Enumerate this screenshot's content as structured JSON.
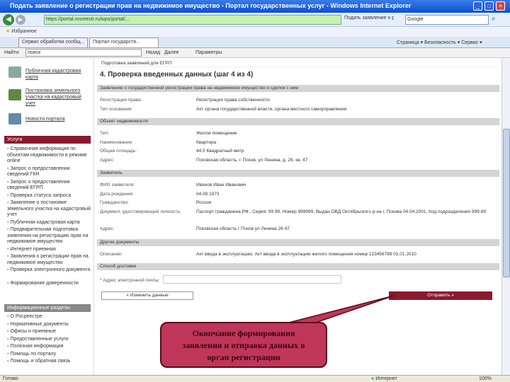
{
  "window": {
    "title": "Подать заявление о регистрации прав на недвижимое имущество - Портал государственных услуг - Windows Internet Explorer"
  },
  "browser": {
    "url": "https://portal.rosreestr.ru/wps/portal/...",
    "page_label": "Подать заявление о регистрации...",
    "search_placeholder": "Google",
    "favorites": "Избранное",
    "tabs": [
      {
        "label": "Сервис обработки сообщ..."
      },
      {
        "label": "Портал государств..."
      }
    ],
    "toolbar_right": [
      "Страница",
      "Безопасность",
      "Сервис"
    ],
    "find_label": "Найти:",
    "find_value": "поиск",
    "find_prev": "Назад",
    "find_next": "Далее",
    "find_options": "Параметры"
  },
  "sidebar": {
    "top_links": [
      {
        "label": "Публичная кадастровая карта"
      },
      {
        "label": "Постановка земельного участка на кадастровый учет"
      },
      {
        "label": "Новости портала"
      }
    ],
    "services_title": "Услуги",
    "services": [
      "Справочная информация по объектам недвижимости в режиме online",
      "Запрос о предоставлении сведений ГКН",
      "Запрос о предоставлении сведений ЕГРП",
      "Проверка статуса запроса",
      "Заявление о постановке земельного участка на кадастровый учет",
      "Публичная кадастровая карта",
      "Предварительная подготовка заявления на регистрацию прав на недвижимое имущество",
      "Интернет приемная",
      "Заявления о регистрации прав на недвижимое имущество",
      "Проверка электронного документа",
      "Формирование доверенности"
    ],
    "info_title": "Информационные разделы",
    "info": [
      "О Росреестре",
      "Нормативные документы",
      "Офисы и приемные",
      "Предоставленные услуги",
      "Полезная информация",
      "Помощь по порталу",
      "Помощь и обратная связь"
    ]
  },
  "main": {
    "breadcrumb": "Подготовка заявлений для ЕГРП",
    "heading": "4. Проверка введенных данных (шаг 4 из 4)",
    "sections": [
      {
        "title": "Заявление о государственной регистрации права на недвижимое имущество и сделок с ним",
        "rows": [
          [
            "Регистрация права:",
            "Регистрация права собственности"
          ],
          [
            "Тип основания:",
            "Акт органа государственной власти, органа местного самоуправления"
          ]
        ]
      },
      {
        "title": "Объект недвижимости",
        "rows": [
          [
            "Тип:",
            "Жилое помещение"
          ],
          [
            "Наименование:",
            "Квартира"
          ],
          [
            "Общая площадь:",
            "44.5 Квадратный метр"
          ],
          [
            "Адрес:",
            "Псковская область, г. Псков, ул Ленина, д. 26, кв. 47"
          ]
        ]
      },
      {
        "title": "Заявитель",
        "rows": [
          [
            "ФИО заявителя:",
            "Иванов Иван Иванович"
          ],
          [
            "Дата рождения:",
            "04.08.1973"
          ],
          [
            "Гражданство:",
            "Россия"
          ],
          [
            "Документ, удостоверяющий личность:",
            "Паспорт гражданина РФ , Серия: 99 99, Номер 999999, Выдан ОВД Октябрьского р-на г. Пскова 04.04.2001, Код подразделения 999-99"
          ],
          [
            "Адрес:",
            "Псковская область г Псков ул Ленина 26 47"
          ]
        ]
      },
      {
        "title": "Другие документы",
        "rows": [
          [
            "Описание:",
            "Акт ввода в эксплуатацию, Акт ввода в эксплуатацию жилого помещения номер 123456789 01.01.2010"
          ]
        ]
      },
      {
        "title": "Способ доставки",
        "rows": []
      }
    ],
    "email_label": "* Адрес электронной почты:",
    "email_value": "",
    "back_button": "« Изменить данные",
    "send_button": "Отправить »"
  },
  "callout": {
    "line1": "Окончание формирования",
    "line2": "заявления и отправка данных в",
    "line3": "орган регистрации"
  },
  "status": {
    "left": "Готово",
    "zone": "Интернет",
    "zoom": "100%"
  }
}
